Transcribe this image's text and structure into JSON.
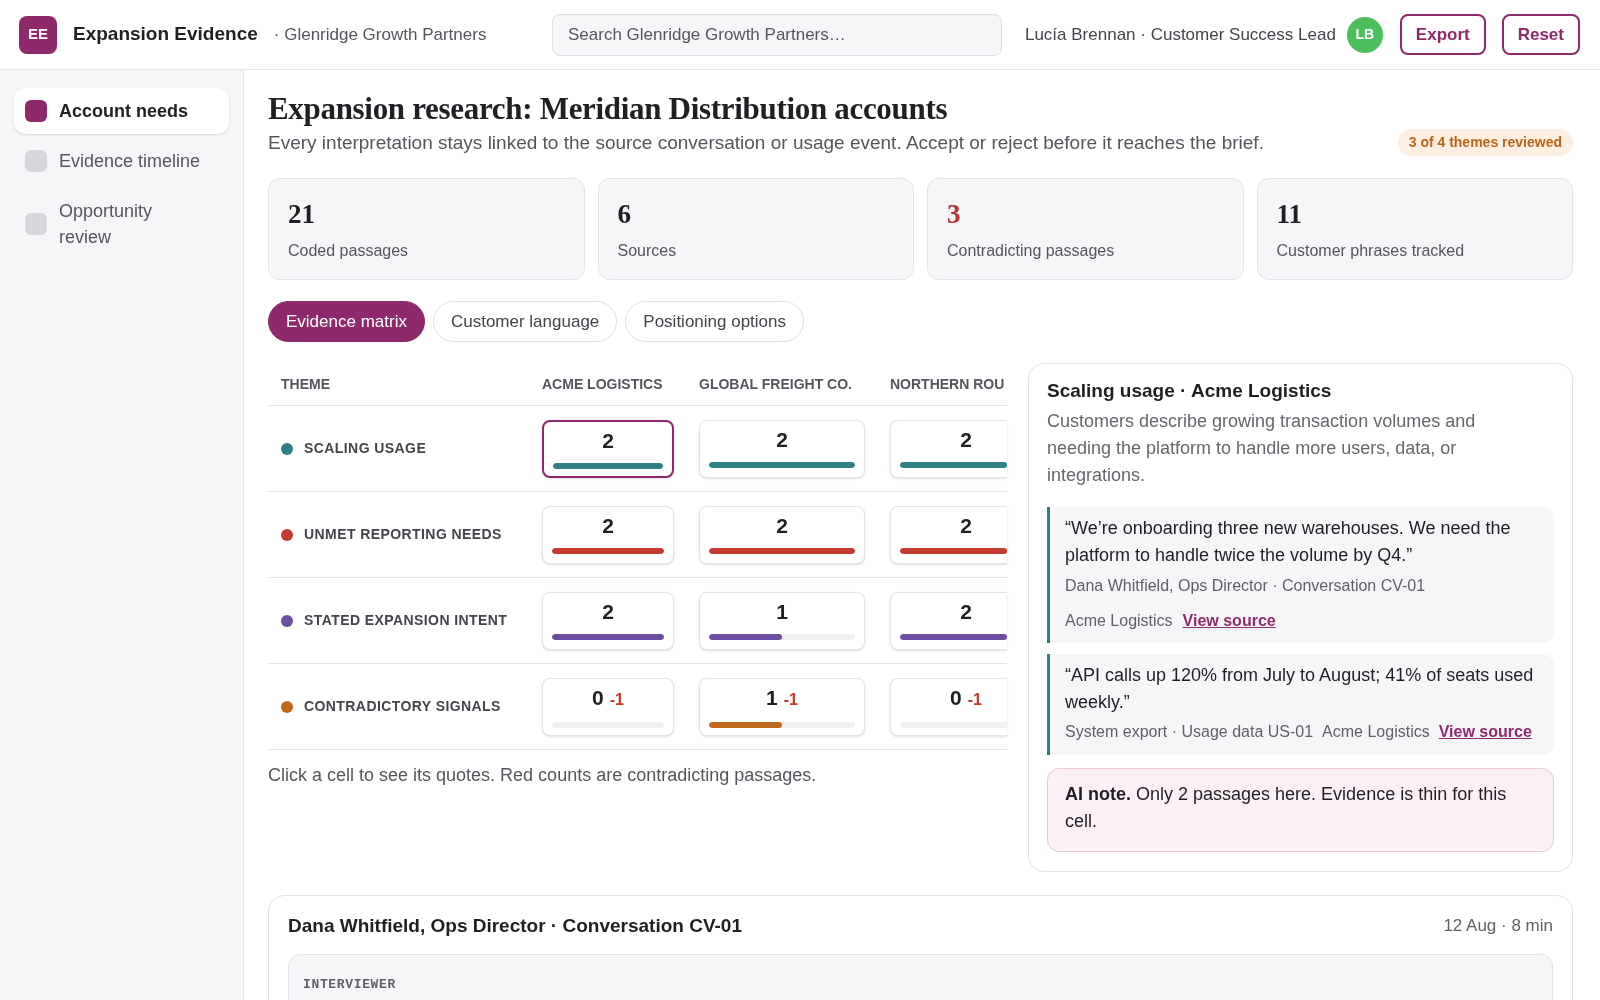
{
  "header": {
    "logo": "EE",
    "app_title": "Expansion Evidence",
    "workspace": "· Glenridge Growth Partners",
    "search": {
      "placeholder": "Search Glenridge Growth Partners…"
    },
    "user": "Lucía Brennan · Customer Success Lead",
    "avatar": "LB",
    "buttons": [
      "Export",
      "Reset"
    ]
  },
  "sidebar": {
    "items": [
      {
        "label": "Account needs",
        "selected": true
      },
      {
        "label": "Evidence timeline",
        "selected": false
      },
      {
        "label": "Opportunity review",
        "selected": false
      }
    ]
  },
  "page": {
    "title": "Expansion research: Meridian Distribution accounts",
    "subtitle": "Every interpretation stays linked to the source conversation or usage event. Accept or reject before it reaches the brief.",
    "badge": "3 of 4 themes reviewed"
  },
  "stats": [
    {
      "value": "21",
      "label": "Coded passages",
      "kind": "normal"
    },
    {
      "value": "6",
      "label": "Sources",
      "kind": "normal"
    },
    {
      "value": "3",
      "label": "Contradicting passages",
      "kind": "alert"
    },
    {
      "value": "11",
      "label": "Customer phrases tracked",
      "kind": "normal"
    }
  ],
  "tabs": [
    {
      "label": "Evidence matrix",
      "selected": true
    },
    {
      "label": "Customer language",
      "selected": false
    },
    {
      "label": "Positioning options",
      "selected": false
    }
  ],
  "matrix": {
    "theme_header": "THEME",
    "columns": [
      "ACME LOGISTICS",
      "GLOBAL FREIGHT CO.",
      "NORTHERN ROU"
    ],
    "rows": [
      {
        "theme": "SCALING USAGE",
        "color": "#2f7f86",
        "cells": [
          {
            "count": "2",
            "level": 1,
            "selected": true
          },
          {
            "count": "2",
            "level": 1,
            "selected": false
          },
          {
            "count": "2",
            "level": 1,
            "selected": false
          }
        ]
      },
      {
        "theme": "UNMET REPORTING NEEDS",
        "color": "#c63b2f",
        "cells": [
          {
            "count": "2",
            "level": 1,
            "selected": false
          },
          {
            "count": "2",
            "level": 1,
            "selected": false
          },
          {
            "count": "2",
            "level": 1,
            "selected": false
          }
        ]
      },
      {
        "theme": "STATED EXPANSION INTENT",
        "color": "#6e4ea3",
        "cells": [
          {
            "count": "2",
            "level": 1,
            "selected": false
          },
          {
            "count": "1",
            "level": 0.5,
            "selected": false
          },
          {
            "count": "2",
            "level": 1,
            "selected": false
          }
        ]
      },
      {
        "theme": "CONTRADICTORY SIGNALS",
        "color": "#c0691d",
        "cells": [
          {
            "count": "0",
            "contradicting": "-1",
            "level": 0,
            "selected": false
          },
          {
            "count": "1",
            "contradicting": "-1",
            "level": 0.5,
            "selected": false
          },
          {
            "count": "0",
            "contradicting": "-1",
            "level": 0,
            "selected": false
          }
        ]
      }
    ],
    "hint": "Click a cell to see its quotes. Red counts are contradicting passages."
  },
  "detail": {
    "title": "Scaling usage · Acme Logistics",
    "description": "Customers describe growing transaction volumes and needing the platform to handle more users, data, or integrations.",
    "quotes": [
      {
        "kind": "conversation",
        "text": "“We’re onboarding three new warehouses. We need the platform to handle twice the volume by Q4.”",
        "attribution": "Dana Whitfield, Ops Director · Conversation CV-01",
        "account": "Acme Logistics",
        "link": "View source"
      },
      {
        "kind": "usage",
        "text": "“API calls up 120% from July to August; 41% of seats used weekly.”",
        "attribution": "System export · Usage data US-01",
        "account": "Acme Logistics",
        "link": "View source"
      }
    ],
    "note": "**AI note.** Only 2 passages here. Evidence is thin for this cell."
  },
  "transcript": {
    "title": "Dana Whitfield, Ops Director · Conversation CV-01",
    "meta": "12 Aug · 8 min",
    "speaker": "INTERVIEWER"
  }
}
